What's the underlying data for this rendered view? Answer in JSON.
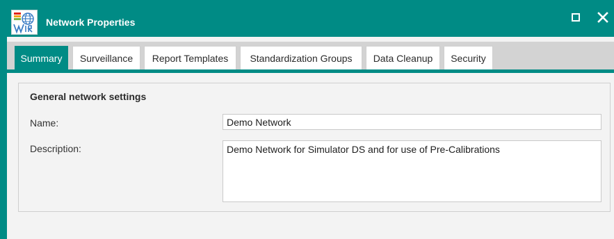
{
  "window": {
    "title": "Network Properties",
    "controls": {
      "maximize_icon": "maximize-icon",
      "close_icon": "close-icon"
    },
    "accent_color": "#008b85"
  },
  "tabs": [
    {
      "label": "Summary",
      "active": true
    },
    {
      "label": "Surveillance",
      "active": false
    },
    {
      "label": "Report Templates",
      "active": false
    },
    {
      "label": "Standardization Groups",
      "active": false
    },
    {
      "label": "Data Cleanup",
      "active": false
    },
    {
      "label": "Security",
      "active": false
    }
  ],
  "summary": {
    "group_title": "General network settings",
    "name_label": "Name:",
    "name_value": "Demo Network",
    "description_label": "Description:",
    "description_value": "Demo Network for Simulator DS and for use of Pre-Calibrations"
  }
}
